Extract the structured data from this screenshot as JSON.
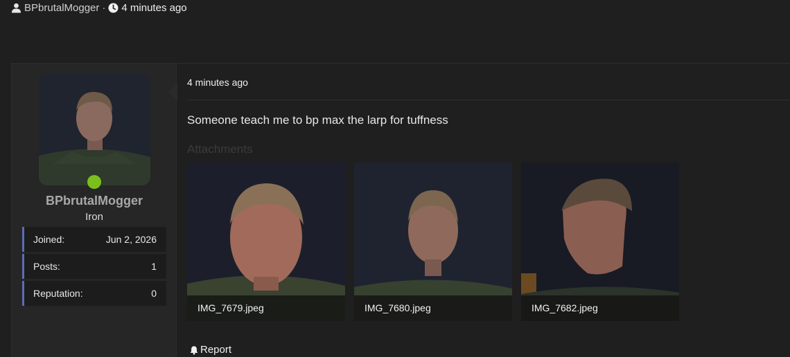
{
  "thread": {
    "author": "BPbrutalMogger",
    "separator": "·",
    "time": "4 minutes ago",
    "icons": [
      "user-icon",
      "clock-icon"
    ]
  },
  "user": {
    "name": "BPbrutalMogger",
    "rank": "Iron",
    "status_color": "#7bbf1e",
    "stats": [
      {
        "label": "Joined:",
        "value": "Jun 2, 2026"
      },
      {
        "label": "Posts:",
        "value": "1"
      },
      {
        "label": "Reputation:",
        "value": "0"
      }
    ]
  },
  "post": {
    "time": "4 minutes ago",
    "body": "Someone teach me to bp max the larp for tuffness",
    "attachments_title": "Attachments",
    "attachments": [
      {
        "filename": "IMG_7679.jpeg"
      },
      {
        "filename": "IMG_7680.jpeg"
      },
      {
        "filename": "IMG_7682.jpeg"
      }
    ],
    "report_label": "Report",
    "report_icon": "bell-icon"
  },
  "colors": {
    "background": "#1f1f1f",
    "sidebar": "#262626",
    "stat_accent": "#5a6fb3",
    "muted_heading": "#3b3b3b"
  }
}
